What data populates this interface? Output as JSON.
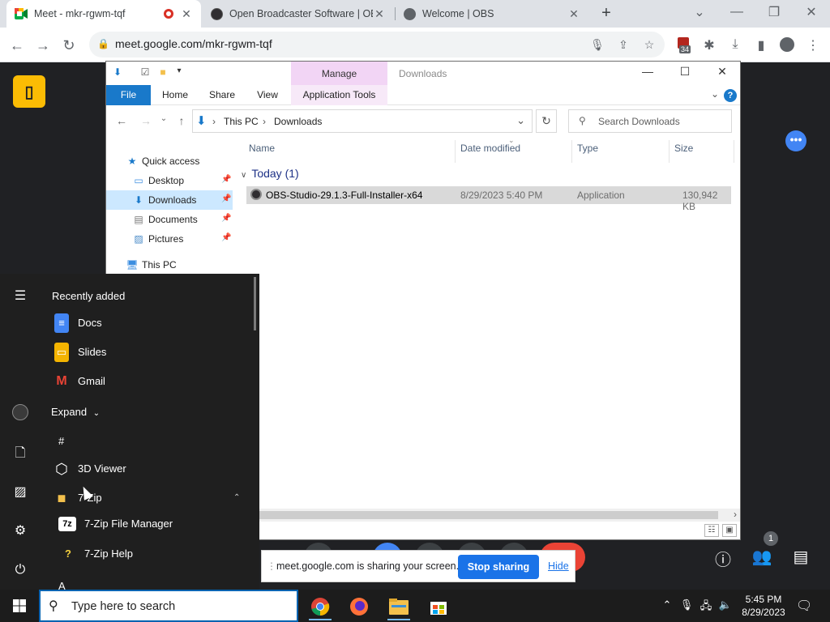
{
  "browser": {
    "tabs": [
      {
        "title": "Meet - mkr-rgwm-tqf",
        "recording": true
      },
      {
        "title": "Open Broadcaster Software | OBS"
      },
      {
        "title": "Welcome | OBS"
      }
    ],
    "new_tab": "+",
    "url": "meet.google.com/mkr-rgwm-tqf",
    "extension_badge": "34"
  },
  "explorer": {
    "title": "Downloads",
    "manage_tab": "Manage",
    "ribbon_tabs": [
      "File",
      "Home",
      "Share",
      "View",
      "Application Tools"
    ],
    "breadcrumb": [
      "This PC",
      "Downloads"
    ],
    "search_placeholder": "Search Downloads",
    "nav_items": [
      {
        "label": "Quick access"
      },
      {
        "label": "Desktop"
      },
      {
        "label": "Downloads"
      },
      {
        "label": "Documents"
      },
      {
        "label": "Pictures"
      },
      {
        "label": "This PC"
      }
    ],
    "columns": [
      "Name",
      "Date modified",
      "Type",
      "Size"
    ],
    "group_label": "Today (1)",
    "files": [
      {
        "name": "OBS-Studio-29.1.3-Full-Installer-x64",
        "date": "8/29/2023 5:40 PM",
        "type": "Application",
        "size": "130,942 KB"
      }
    ]
  },
  "start_menu": {
    "header": "Recently added",
    "recent": [
      "Docs",
      "Slides",
      "Gmail"
    ],
    "expand": "Expand",
    "letters": [
      "#",
      "A"
    ],
    "apps": [
      "3D Viewer",
      "7-Zip",
      "7-Zip File Manager",
      "7-Zip Help"
    ]
  },
  "sharing": {
    "message": "meet.google.com is sharing your screen.",
    "stop": "Stop sharing",
    "hide": "Hide"
  },
  "meet": {
    "people_count": "1"
  },
  "taskbar": {
    "search_placeholder": "Type here to search",
    "time": "5:45 PM",
    "date": "8/29/2023"
  }
}
